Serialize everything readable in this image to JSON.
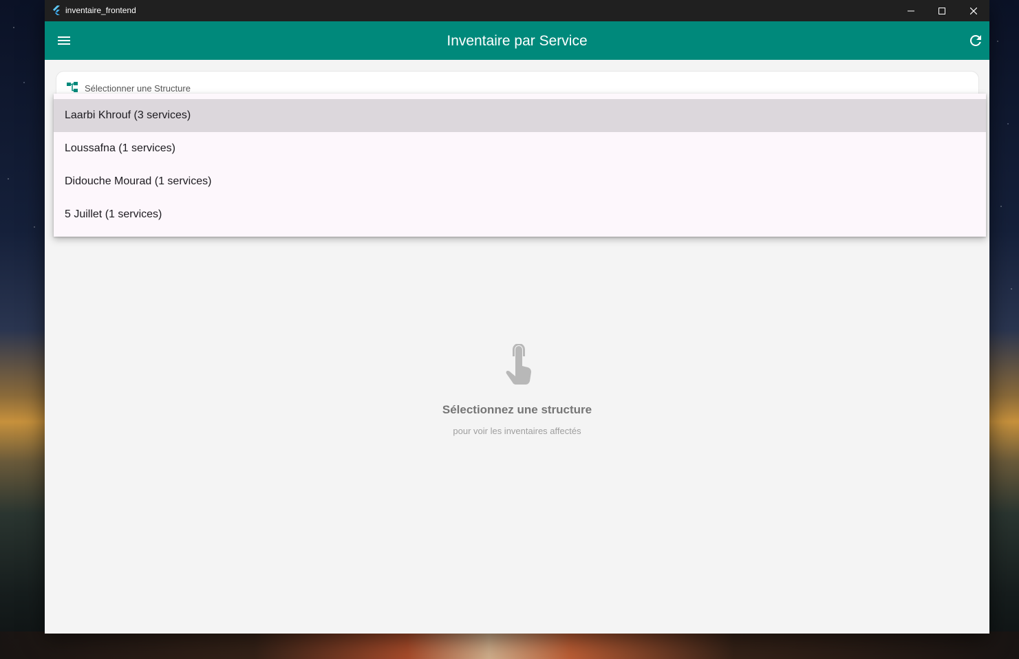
{
  "window": {
    "title": "inventaire_frontend"
  },
  "appbar": {
    "title": "Inventaire par Service",
    "menu_icon": "menu-icon",
    "refresh_icon": "refresh-icon",
    "color": "#00897b"
  },
  "selector": {
    "label": "Sélectionner une Structure",
    "icon": "account-tree-icon"
  },
  "dropdown": {
    "options": [
      {
        "label": "Laarbi Khrouf (3 services)",
        "selected": true
      },
      {
        "label": "Loussafna (1 services)",
        "selected": false
      },
      {
        "label": "Didouche Mourad (1 services)",
        "selected": false
      },
      {
        "label": "5 Juillet (1 services)",
        "selected": false
      }
    ]
  },
  "empty_state": {
    "icon": "touch-app-icon",
    "heading": "Sélectionnez une structure",
    "subtext": "pour voir les inventaires affectés"
  }
}
